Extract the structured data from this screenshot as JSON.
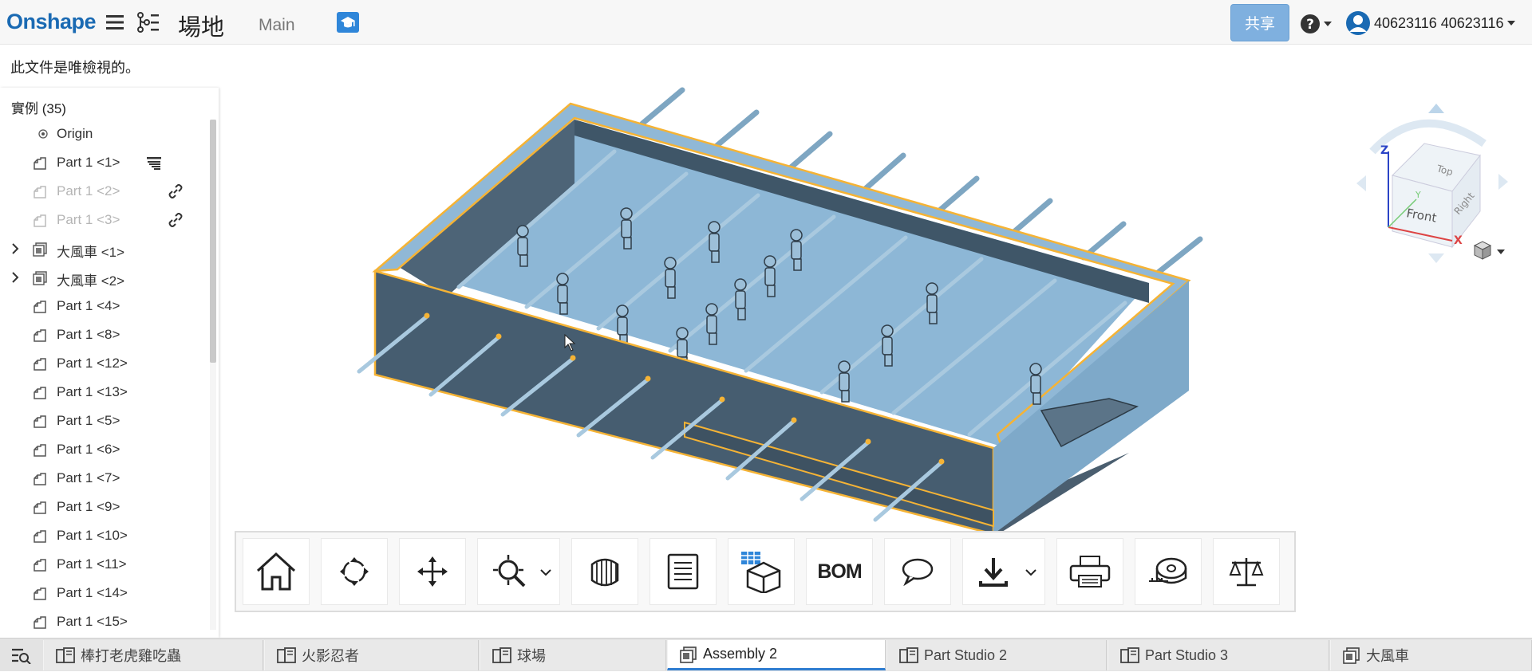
{
  "header": {
    "logo": "Onshape",
    "document_title": "場地",
    "branch": "Main",
    "share_label": "共享",
    "user_name": "40623116 40623116"
  },
  "banner": {
    "readonly_text": "此文件是唯檢視的。"
  },
  "instances": {
    "title": "實例 (35)",
    "items": [
      {
        "label": "Origin",
        "icon": "origin-icon",
        "state": "normal"
      },
      {
        "label": "Part 1 <1>",
        "icon": "part-icon",
        "state": "normal",
        "action": "section-icon"
      },
      {
        "label": "Part 1 <2>",
        "icon": "part-icon",
        "state": "dimmed",
        "action": "link-icon"
      },
      {
        "label": "Part 1 <3>",
        "icon": "part-icon",
        "state": "dimmed",
        "action": "link-icon"
      },
      {
        "label": "大風車 <1>",
        "icon": "subassembly-icon",
        "state": "normal",
        "expandable": true
      },
      {
        "label": "大風車 <2>",
        "icon": "subassembly-icon",
        "state": "normal",
        "expandable": true
      },
      {
        "label": "Part 1 <4>",
        "icon": "part-icon",
        "state": "normal"
      },
      {
        "label": "Part 1 <8>",
        "icon": "part-icon",
        "state": "normal"
      },
      {
        "label": "Part 1 <12>",
        "icon": "part-icon",
        "state": "normal"
      },
      {
        "label": "Part 1 <13>",
        "icon": "part-icon",
        "state": "normal"
      },
      {
        "label": "Part 1 <5>",
        "icon": "part-icon",
        "state": "normal"
      },
      {
        "label": "Part 1 <6>",
        "icon": "part-icon",
        "state": "normal"
      },
      {
        "label": "Part 1 <7>",
        "icon": "part-icon",
        "state": "normal"
      },
      {
        "label": "Part 1 <9>",
        "icon": "part-icon",
        "state": "normal"
      },
      {
        "label": "Part 1 <10>",
        "icon": "part-icon",
        "state": "normal"
      },
      {
        "label": "Part 1 <11>",
        "icon": "part-icon",
        "state": "normal"
      },
      {
        "label": "Part 1 <14>",
        "icon": "part-icon",
        "state": "normal"
      },
      {
        "label": "Part 1 <15>",
        "icon": "part-icon",
        "state": "normal"
      }
    ]
  },
  "viewcube": {
    "faces": [
      "Top",
      "Front",
      "Right"
    ],
    "axes": [
      "Z",
      "Y",
      "X"
    ]
  },
  "toolbar": {
    "tools": [
      {
        "name": "home-view-icon"
      },
      {
        "name": "rotate-icon"
      },
      {
        "name": "pan-icon"
      },
      {
        "name": "zoom-icon",
        "has_dropdown": true
      },
      {
        "name": "section-view-icon"
      },
      {
        "name": "properties-icon"
      },
      {
        "name": "explode-table-icon"
      },
      {
        "name": "bom-button",
        "label": "BOM"
      },
      {
        "name": "comment-icon"
      },
      {
        "name": "download-icon",
        "has_dropdown": true
      },
      {
        "name": "print-icon"
      },
      {
        "name": "measure-icon"
      },
      {
        "name": "mass-properties-icon"
      }
    ]
  },
  "tabs": [
    {
      "label": "棒打老虎雞吃蟲",
      "icon": "part-studio-icon",
      "active": false
    },
    {
      "label": "火影忍者",
      "icon": "part-studio-icon",
      "active": false
    },
    {
      "label": "球場",
      "icon": "part-studio-icon",
      "active": false
    },
    {
      "label": "Assembly 2",
      "icon": "assembly-icon",
      "active": true
    },
    {
      "label": "Part Studio 2",
      "icon": "part-studio-icon",
      "active": false
    },
    {
      "label": "Part Studio 3",
      "icon": "part-studio-icon",
      "active": false
    },
    {
      "label": "大風車",
      "icon": "assembly-icon",
      "active": false
    }
  ],
  "colors": {
    "accent": "#1a6ab3",
    "share": "#7fb0df",
    "model": "#8ab6d6",
    "highlight": "#f5b335"
  }
}
